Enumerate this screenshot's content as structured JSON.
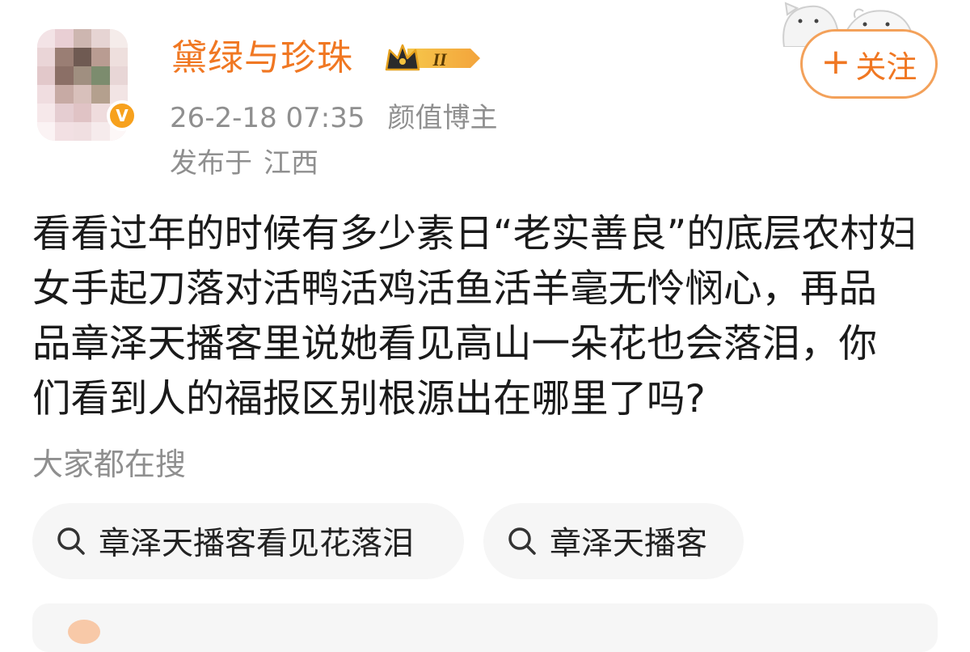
{
  "author": {
    "name": "黛绿与珍珠",
    "vip_level": "II",
    "verified_mark": "V"
  },
  "post": {
    "timestamp": "26-2-18 07:35",
    "author_tag": "颜值博主",
    "location_prefix": "发布于",
    "location": "江西",
    "lines": [
      "看看过年的时候有多少素日“老实善良”的底层农村妇",
      "女手起刀落对活鸭活鸡活鱼活羊毫无怜悯心，再品",
      "品章泽天播客里说她看见高山一朵花也会落泪，你",
      "们看到人的福报区别根源出在哪里了吗?"
    ]
  },
  "follow_button": {
    "plus": "+",
    "label": "关注"
  },
  "search_section": {
    "title": "大家都在搜",
    "chips": [
      {
        "label": "章泽天播客看见花落泪"
      },
      {
        "label": "章泽天播客"
      }
    ]
  },
  "icons": {
    "verified": "verified-v-icon",
    "vip": "crown-vip-badge-icon",
    "search": "search-icon",
    "decoration": "cartoon-cat-icon"
  },
  "colors": {
    "accent": "#f07722",
    "secondary_text": "#8f8f8f",
    "chip_background": "#f6f6f6",
    "verified": "#f7a11d"
  }
}
